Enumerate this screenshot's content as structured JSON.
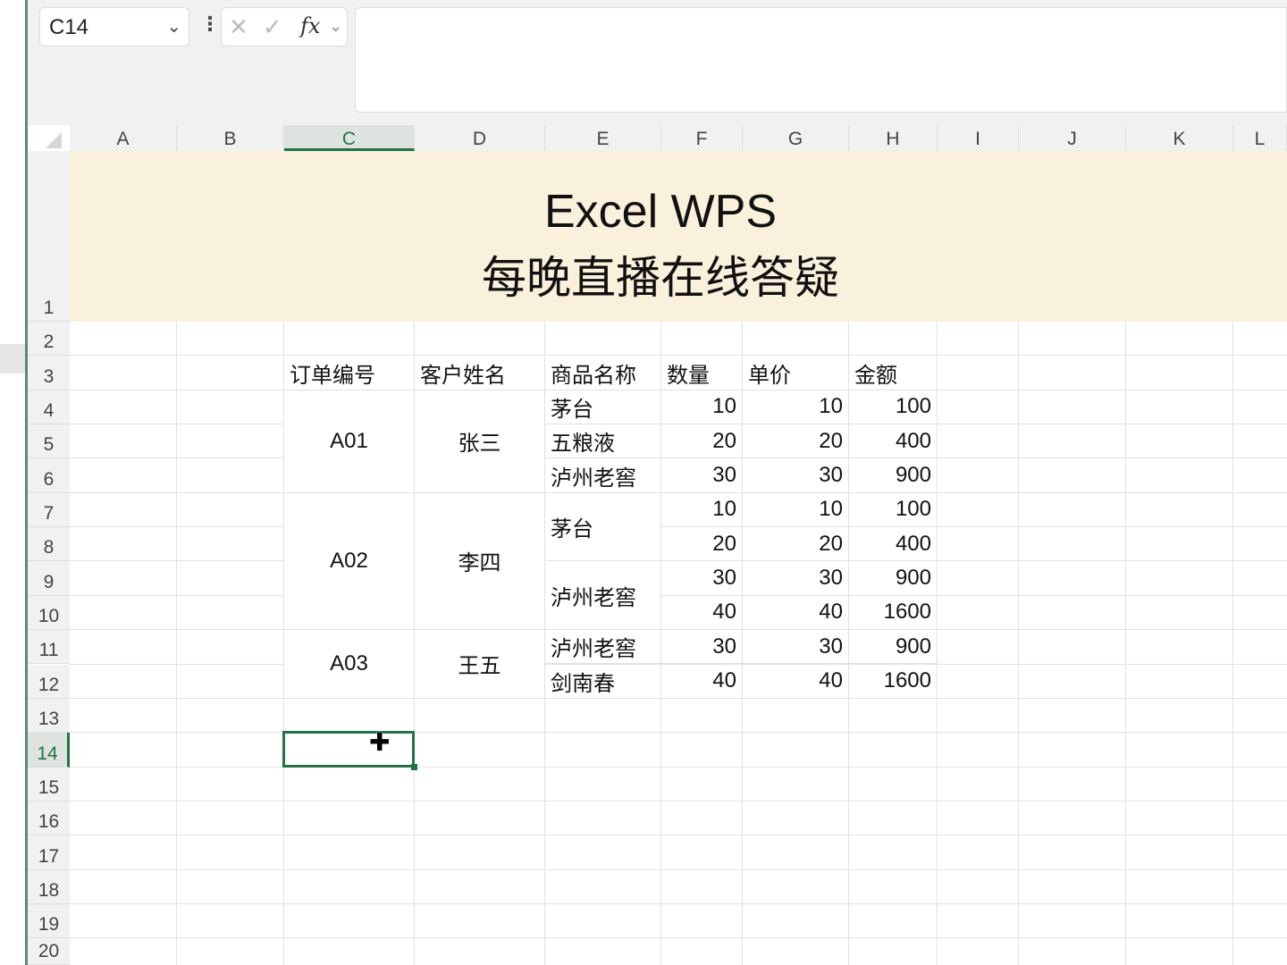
{
  "toolbar": {
    "name_box": "C14",
    "fx_label": "fx",
    "formula_value": ""
  },
  "columns": [
    "A",
    "B",
    "C",
    "D",
    "E",
    "F",
    "G",
    "H",
    "I",
    "J",
    "K",
    "L"
  ],
  "rows": [
    "1",
    "2",
    "3",
    "4",
    "5",
    "6",
    "7",
    "8",
    "9",
    "10",
    "11",
    "12",
    "13",
    "14",
    "15",
    "16",
    "17",
    "18",
    "19",
    "20"
  ],
  "selected_cell": "C14",
  "banner": {
    "line1": "Excel WPS",
    "line2": "每晚直播在线答疑"
  },
  "table": {
    "headers": [
      "订单编号",
      "客户姓名",
      "商品名称",
      "数量",
      "单价",
      "金额"
    ],
    "orders": [
      {
        "id": "A01",
        "customer": "张三"
      },
      {
        "id": "A02",
        "customer": "李四"
      },
      {
        "id": "A03",
        "customer": "王五"
      }
    ],
    "products": [
      "茅台",
      "五粮液",
      "泸州老窖",
      "茅台",
      "泸州老窖",
      "泸州老窖",
      "剑南春"
    ],
    "quantity": [
      "10",
      "20",
      "30",
      "10",
      "20",
      "30",
      "40",
      "30",
      "40"
    ],
    "price": [
      "10",
      "20",
      "30",
      "10",
      "20",
      "30",
      "40",
      "30",
      "40"
    ],
    "amount": [
      "100",
      "400",
      "900",
      "100",
      "400",
      "900",
      "1600",
      "900",
      "1600"
    ]
  }
}
